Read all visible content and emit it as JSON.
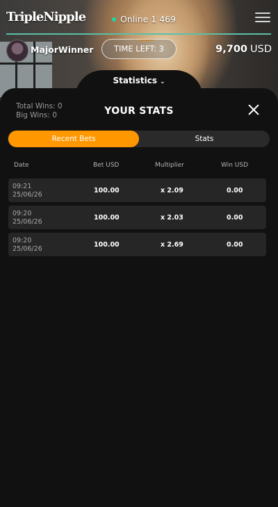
{
  "header": {
    "logo": "TripleNipple",
    "online_label": "Online 1 469"
  },
  "user": {
    "name": "MajorWinner",
    "time_left": "TIME LEFT: 3",
    "balance_amount": "9,700",
    "balance_currency": "USD"
  },
  "statistics_tab": {
    "label": "Statistics",
    "chevron": "⌄"
  },
  "panel": {
    "total_wins": "Total Wins: 0",
    "big_wins": "Big Wins: 0",
    "title": "YOUR STATS",
    "tabs": [
      {
        "label": "Recent Bets",
        "active": true
      },
      {
        "label": "Stats",
        "active": false
      }
    ],
    "columns": [
      "Date",
      "Bet USD",
      "Multiplier",
      "Win USD"
    ],
    "rows": [
      {
        "time": "09:21",
        "date": "25/06/26",
        "bet": "100.00",
        "multiplier": "x 2.09",
        "win": "0.00"
      },
      {
        "time": "09:20",
        "date": "25/06/26",
        "bet": "100.00",
        "multiplier": "x 2.03",
        "win": "0.00"
      },
      {
        "time": "09:20",
        "date": "25/06/26",
        "bet": "100.00",
        "multiplier": "x 2.69",
        "win": "0.00"
      }
    ]
  },
  "colors": {
    "accent": "#ff9800",
    "online_dot": "#1fd6a0",
    "progress_bar": "#5bbfa8"
  },
  "icons": [
    "menu-icon",
    "close-icon",
    "chevron-down-icon",
    "online-dot-icon"
  ]
}
